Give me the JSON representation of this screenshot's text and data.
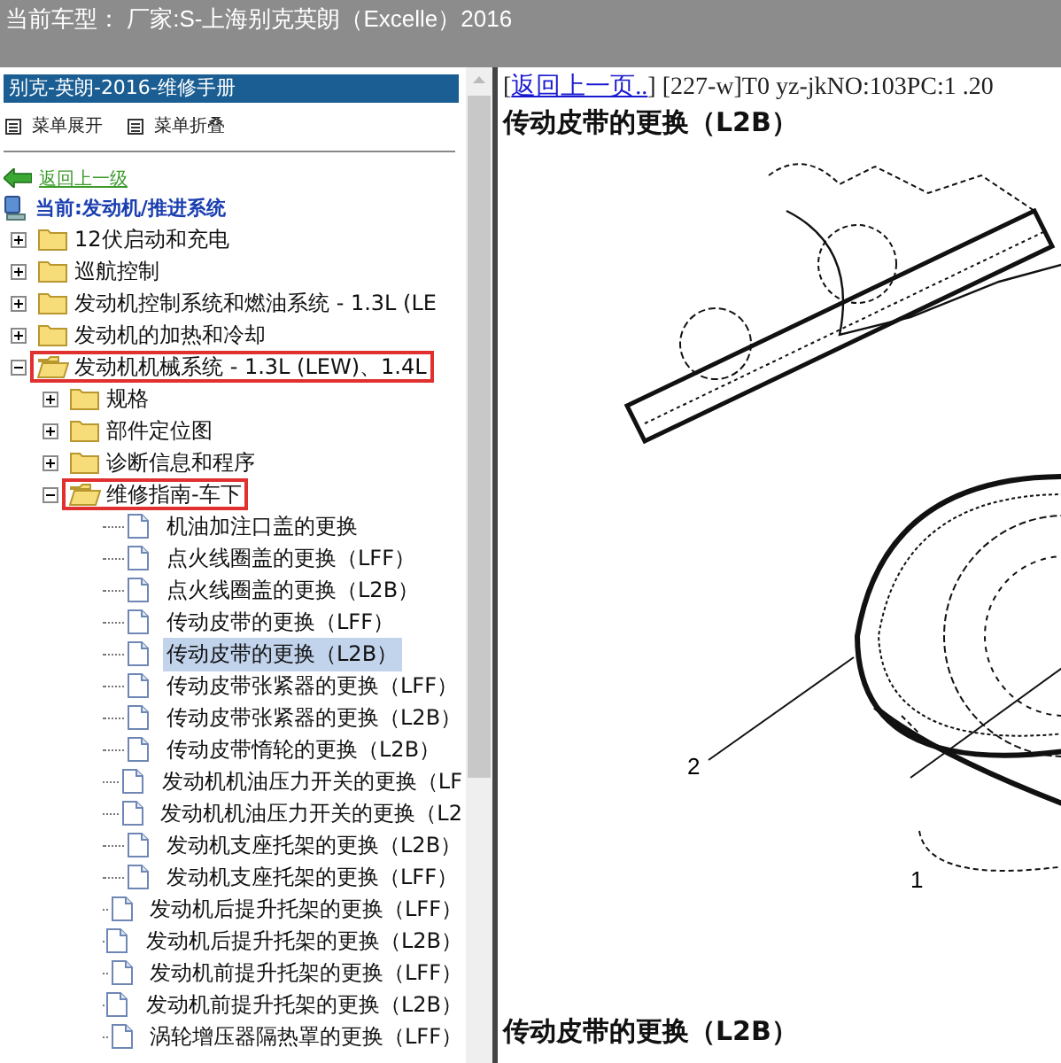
{
  "header": {
    "vehicle": "当前车型： 厂家:S-上海别克英朗（Excelle）2016"
  },
  "sidebar": {
    "title": "别克-英朗-2016-维修手册",
    "menu_actions": [
      {
        "label": "菜单展开"
      },
      {
        "label": "菜单折叠"
      }
    ],
    "back_link": "返回上一级",
    "current_path": "当前:发动机/推进系统",
    "tree": [
      {
        "kind": "folder",
        "label": "12伏启动和充电",
        "expanded": false,
        "highlighted": false
      },
      {
        "kind": "folder",
        "label": "巡航控制",
        "expanded": false,
        "highlighted": false
      },
      {
        "kind": "folder",
        "label": "发动机控制系统和燃油系统 - 1.3L (LE",
        "expanded": false,
        "highlighted": false
      },
      {
        "kind": "folder",
        "label": "发动机的加热和冷却",
        "expanded": false,
        "highlighted": false
      },
      {
        "kind": "folder",
        "label": "发动机机械系统 - 1.3L (LEW)、1.4L",
        "expanded": true,
        "highlighted": true,
        "children": [
          {
            "kind": "folder",
            "label": "规格",
            "expanded": false,
            "highlighted": false
          },
          {
            "kind": "folder",
            "label": "部件定位图",
            "expanded": false,
            "highlighted": false
          },
          {
            "kind": "folder",
            "label": "诊断信息和程序",
            "expanded": false,
            "highlighted": false
          },
          {
            "kind": "folder",
            "label": "维修指南-车下",
            "expanded": true,
            "highlighted": true,
            "children": [
              {
                "kind": "document",
                "label": "机油加注口盖的更换",
                "selected": false
              },
              {
                "kind": "document",
                "label": "点火线圈盖的更换（LFF）",
                "selected": false
              },
              {
                "kind": "document",
                "label": "点火线圈盖的更换（L2B）",
                "selected": false
              },
              {
                "kind": "document",
                "label": "传动皮带的更换（LFF）",
                "selected": false
              },
              {
                "kind": "document",
                "label": "传动皮带的更换（L2B）",
                "selected": true
              },
              {
                "kind": "document",
                "label": "传动皮带张紧器的更换（LFF）",
                "selected": false
              },
              {
                "kind": "document",
                "label": "传动皮带张紧器的更换（L2B）",
                "selected": false
              },
              {
                "kind": "document",
                "label": "传动皮带惰轮的更换（L2B）",
                "selected": false
              },
              {
                "kind": "document",
                "label": "发动机机油压力开关的更换（LF",
                "selected": false
              },
              {
                "kind": "document",
                "label": "发动机机油压力开关的更换（L2",
                "selected": false
              },
              {
                "kind": "document",
                "label": "发动机支座托架的更换（L2B）",
                "selected": false
              },
              {
                "kind": "document",
                "label": "发动机支座托架的更换（LFF）",
                "selected": false
              },
              {
                "kind": "document",
                "label": "发动机后提升托架的更换（LFF）",
                "selected": false
              },
              {
                "kind": "document",
                "label": "发动机后提升托架的更换（L2B）",
                "selected": false
              },
              {
                "kind": "document",
                "label": "发动机前提升托架的更换（LFF）",
                "selected": false
              },
              {
                "kind": "document",
                "label": "发动机前提升托架的更换（L2B）",
                "selected": false
              },
              {
                "kind": "document",
                "label": "涡轮增压器隔热罩的更换（LFF）",
                "selected": false
              }
            ]
          }
        ]
      }
    ]
  },
  "content": {
    "before_link": "[",
    "back_link": "返回上一页..",
    "after_link": "] [227-w]T0 yz-jkNO:103PC:1 .20",
    "title": "传动皮带的更换（L2B）",
    "figure": {
      "callouts": [
        "2",
        "1"
      ]
    },
    "next_title": "传动皮带的更换（L2B）"
  }
}
